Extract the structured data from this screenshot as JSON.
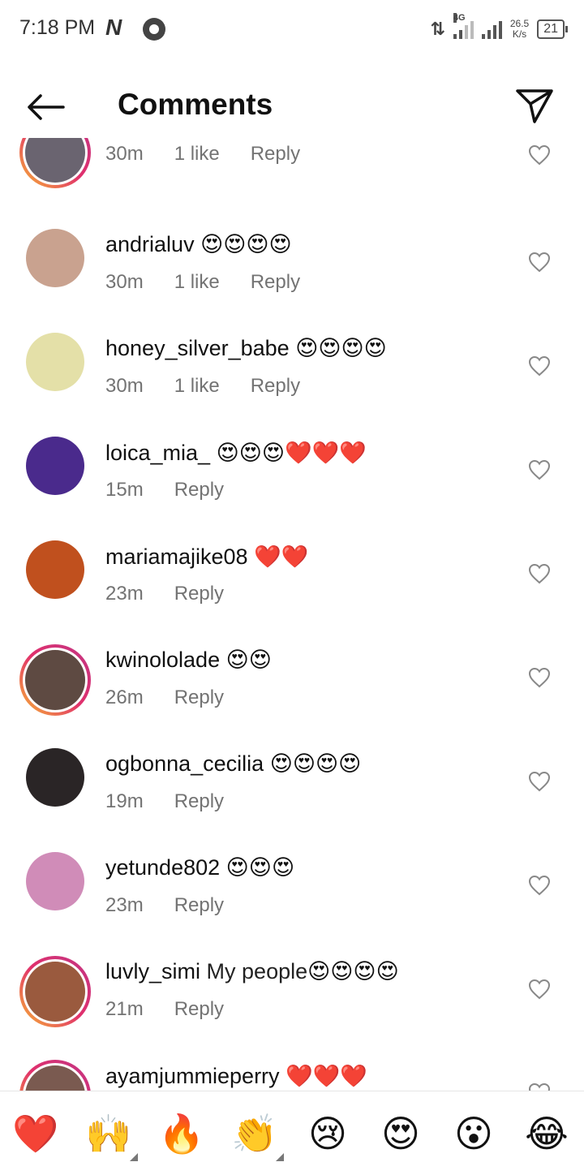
{
  "status_bar": {
    "time": "7:18 PM",
    "network_label": "4G",
    "speed_value": "26.5",
    "speed_unit": "K/s",
    "battery": "21"
  },
  "header": {
    "title": "Comments"
  },
  "comments": [
    {
      "username": "",
      "text": "",
      "emoji": "",
      "time": "30m",
      "likes": "1 like",
      "reply": "Reply",
      "story": true,
      "avatar_color": "#6a6470"
    },
    {
      "username": "andrialuv",
      "text": "",
      "emoji": "😍😍😍😍",
      "time": "30m",
      "likes": "1 like",
      "reply": "Reply",
      "story": false,
      "avatar_color": "#c9a28f"
    },
    {
      "username": "honey_silver_babe",
      "text": "",
      "emoji": "😍😍😍😍",
      "time": "30m",
      "likes": "1 like",
      "reply": "Reply",
      "story": false,
      "avatar_color": "#e4e0a8"
    },
    {
      "username": "loica_mia_",
      "text": "",
      "emoji": "😍😍😍❤️❤️❤️",
      "time": "15m",
      "likes": "",
      "reply": "Reply",
      "story": false,
      "avatar_color": "#4a2a8c"
    },
    {
      "username": "mariamajike08",
      "text": "",
      "emoji": "❤️❤️",
      "time": "23m",
      "likes": "",
      "reply": "Reply",
      "story": false,
      "avatar_color": "#c0501e"
    },
    {
      "username": "kwinololade",
      "text": "",
      "emoji": "😍😍",
      "time": "26m",
      "likes": "",
      "reply": "Reply",
      "story": true,
      "avatar_color": "#5e4a42"
    },
    {
      "username": "ogbonna_cecilia",
      "text": "",
      "emoji": "😍😍😍😍",
      "time": "19m",
      "likes": "",
      "reply": "Reply",
      "story": false,
      "avatar_color": "#2a2526"
    },
    {
      "username": "yetunde802",
      "text": "",
      "emoji": "😍😍😍",
      "time": "23m",
      "likes": "",
      "reply": "Reply",
      "story": false,
      "avatar_color": "#d08cb8"
    },
    {
      "username": "luvly_simi",
      "text": "My people",
      "emoji": "😍😍😍😍",
      "time": "21m",
      "likes": "",
      "reply": "Reply",
      "story": true,
      "avatar_color": "#9a5a3e"
    },
    {
      "username": "ayamjummieperry",
      "text": "",
      "emoji": "❤️❤️❤️",
      "time": "",
      "likes": "",
      "reply": "",
      "story": true,
      "avatar_color": "#7a5a50"
    }
  ],
  "emoji_bar": [
    "❤️",
    "🙌",
    "🔥",
    "👏",
    "😢",
    "😍",
    "😮",
    "😂"
  ]
}
